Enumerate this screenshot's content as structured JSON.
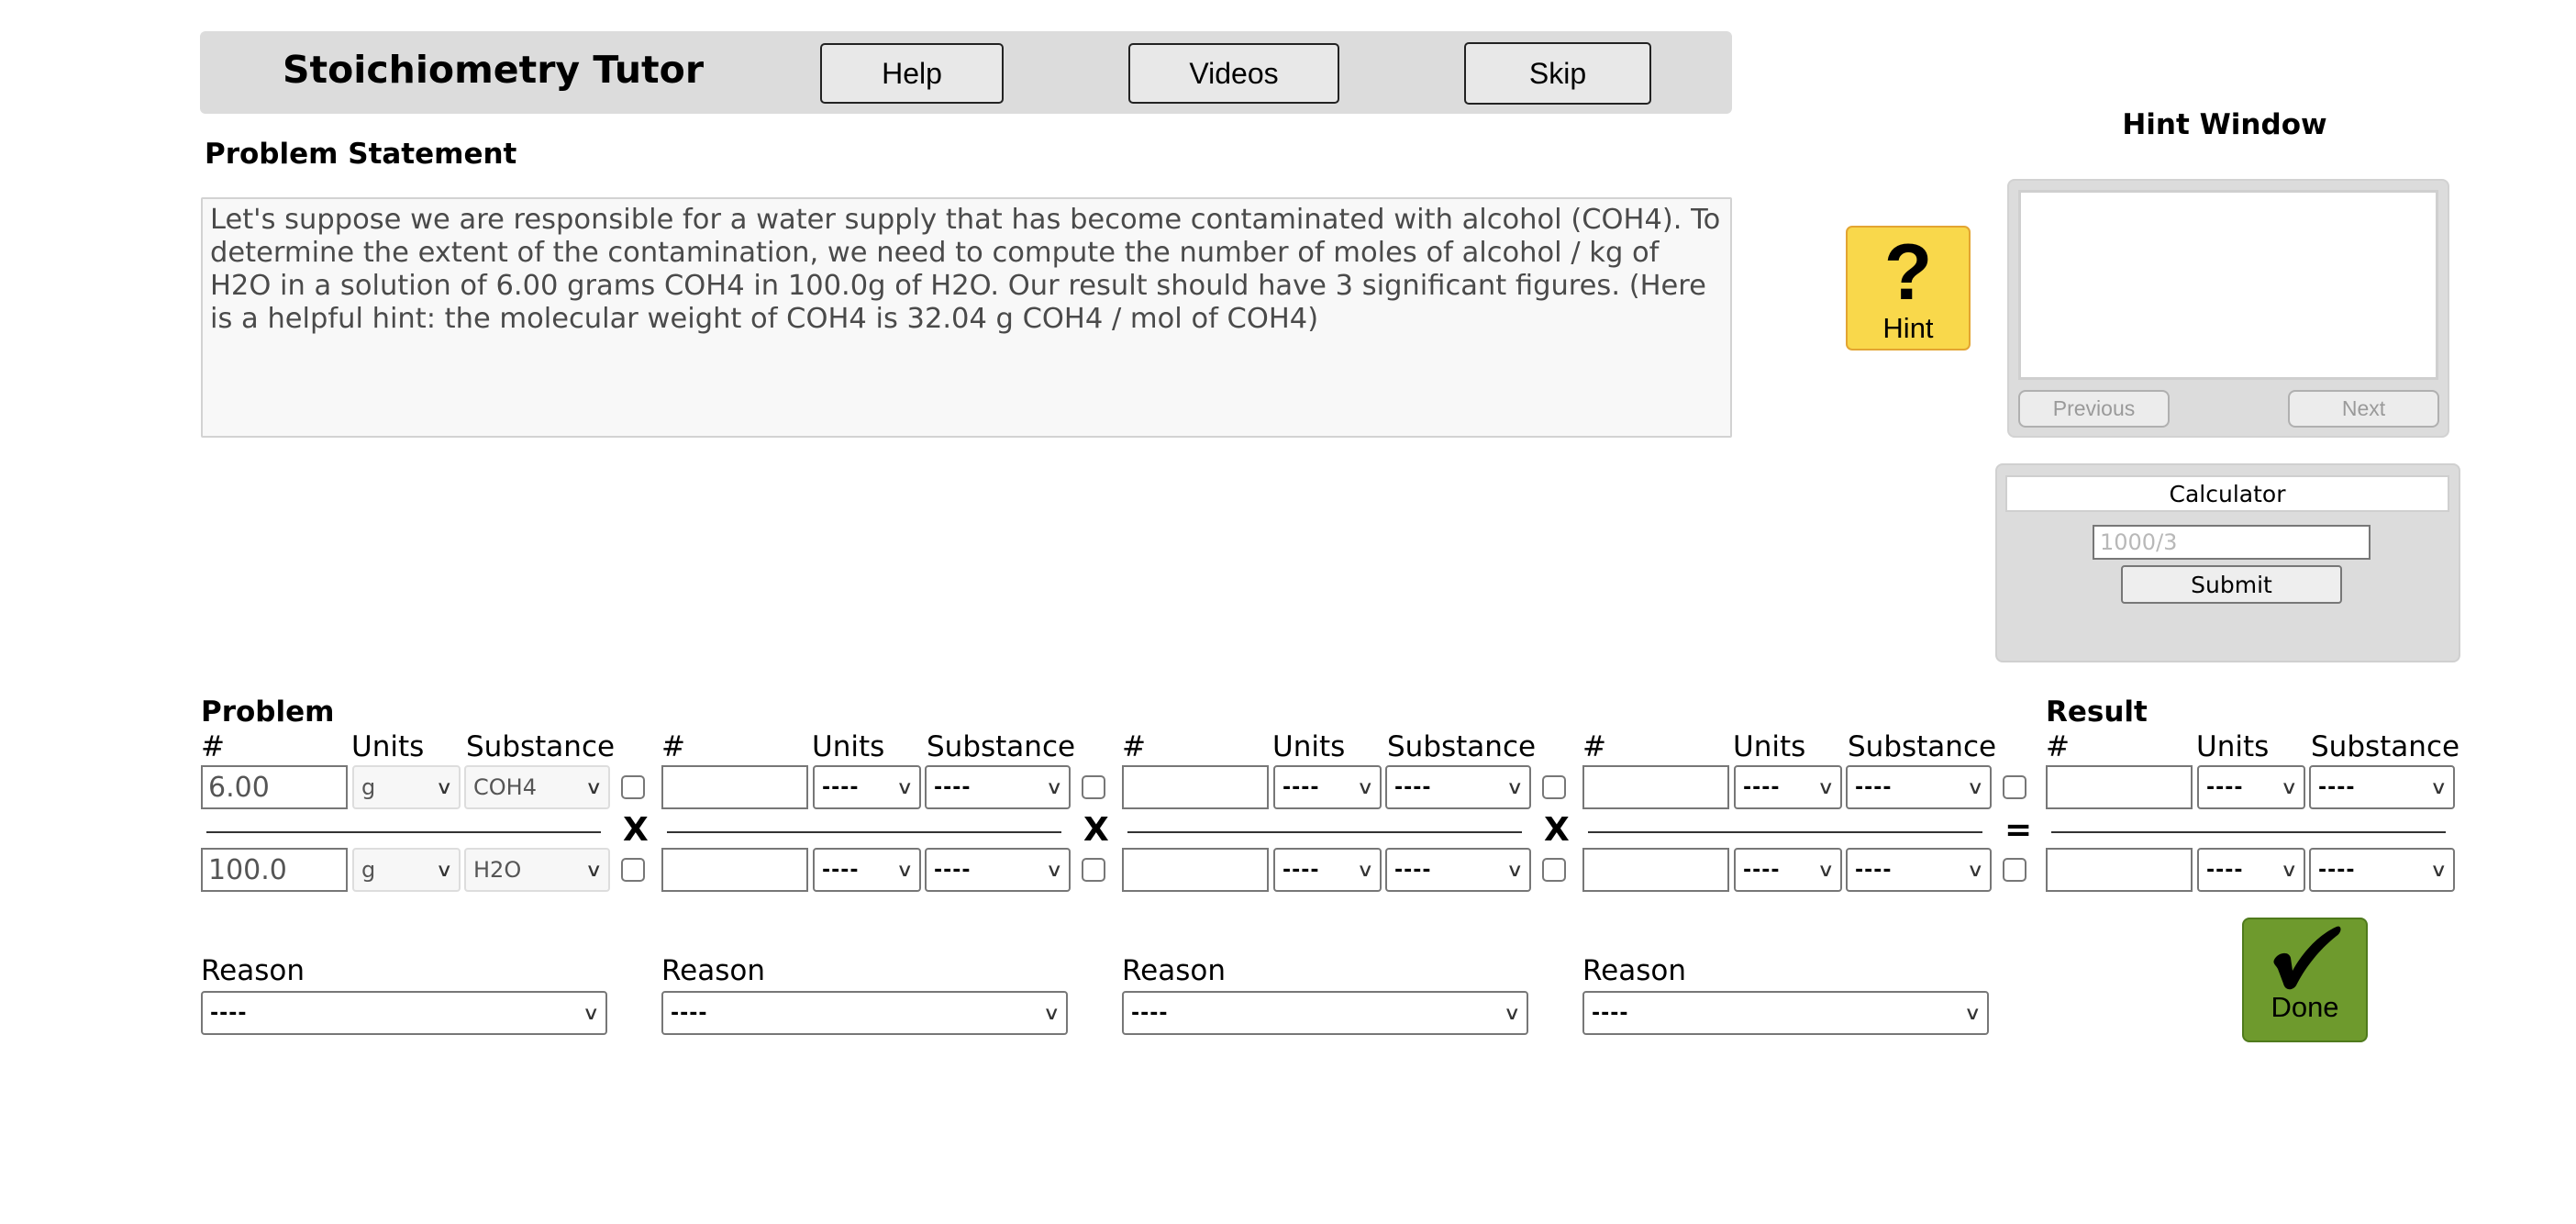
{
  "header": {
    "title": "Stoichiometry Tutor",
    "buttons": {
      "help": "Help",
      "videos": "Videos",
      "skip": "Skip"
    }
  },
  "problem_statement": {
    "label": "Problem Statement",
    "text": "Let's suppose we are responsible for a water supply that has become contaminated with alcohol (COH4). To determine the extent of the contamination, we need to compute the number of moles of alcohol / kg of H2O in a solution of 6.00 grams COH4 in 100.0g of H2O. Our result should have 3 significant figures. (Here is a helpful hint: the molecular weight of COH4 is 32.04 g COH4 / mol of COH4)"
  },
  "hint": {
    "button_icon": "question-mark-icon",
    "button_glyph": "?",
    "button_label": "Hint",
    "window_title": "Hint Window",
    "content": "",
    "previous_label": "Previous",
    "next_label": "Next",
    "button_color": "#f9d84b"
  },
  "calculator": {
    "title": "Calculator",
    "input_value": "",
    "input_placeholder": "1000/3",
    "submit_label": "Submit"
  },
  "grid": {
    "problem_label": "Problem",
    "result_label": "Result",
    "headers": {
      "number": "#",
      "units": "Units",
      "substance": "Substance"
    },
    "operators": [
      "X",
      "X",
      "X",
      "="
    ],
    "terms": [
      {
        "numerator": {
          "number": "6.00",
          "units": "g",
          "substance": "COH4",
          "given": true
        },
        "denominator": {
          "number": "100.0",
          "units": "g",
          "substance": "H2O",
          "given": true
        }
      },
      {
        "numerator": {
          "number": "",
          "units": "----",
          "substance": "----"
        },
        "denominator": {
          "number": "",
          "units": "----",
          "substance": "----"
        }
      },
      {
        "numerator": {
          "number": "",
          "units": "----",
          "substance": "----"
        },
        "denominator": {
          "number": "",
          "units": "----",
          "substance": "----"
        }
      },
      {
        "numerator": {
          "number": "",
          "units": "----",
          "substance": "----"
        },
        "denominator": {
          "number": "",
          "units": "----",
          "substance": "----"
        }
      },
      {
        "numerator": {
          "number": "",
          "units": "----",
          "substance": "----"
        },
        "denominator": {
          "number": "",
          "units": "----",
          "substance": "----"
        }
      }
    ],
    "reasons": [
      {
        "label": "Reason",
        "value": "----"
      },
      {
        "label": "Reason",
        "value": "----"
      },
      {
        "label": "Reason",
        "value": "----"
      },
      {
        "label": "Reason",
        "value": "----"
      }
    ]
  },
  "done": {
    "label": "Done",
    "icon": "checkmark-icon",
    "color": "#6e9a2d"
  }
}
